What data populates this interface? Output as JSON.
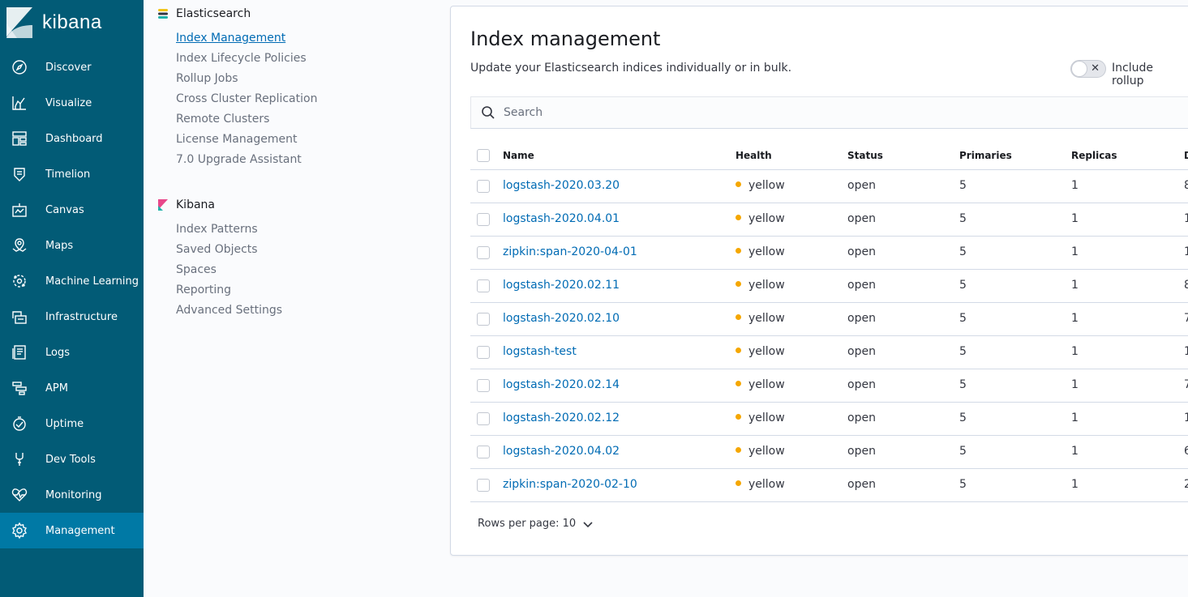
{
  "app": {
    "logo_text": "kibana"
  },
  "nav": [
    {
      "label": "Discover",
      "icon": "compass-icon"
    },
    {
      "label": "Visualize",
      "icon": "chart-icon"
    },
    {
      "label": "Dashboard",
      "icon": "dashboard-icon"
    },
    {
      "label": "Timelion",
      "icon": "timelion-icon"
    },
    {
      "label": "Canvas",
      "icon": "canvas-icon"
    },
    {
      "label": "Maps",
      "icon": "map-icon"
    },
    {
      "label": "Machine Learning",
      "icon": "ml-icon"
    },
    {
      "label": "Infrastructure",
      "icon": "infrastructure-icon"
    },
    {
      "label": "Logs",
      "icon": "logs-icon"
    },
    {
      "label": "APM",
      "icon": "apm-icon"
    },
    {
      "label": "Uptime",
      "icon": "uptime-icon"
    },
    {
      "label": "Dev Tools",
      "icon": "wrench-icon"
    },
    {
      "label": "Monitoring",
      "icon": "heartbeat-icon"
    },
    {
      "label": "Management",
      "icon": "gear-icon",
      "active": true
    }
  ],
  "subnav": {
    "elasticsearch": {
      "title": "Elasticsearch",
      "items": [
        "Index Management",
        "Index Lifecycle Policies",
        "Rollup Jobs",
        "Cross Cluster Replication",
        "Remote Clusters",
        "License Management",
        "7.0 Upgrade Assistant"
      ]
    },
    "kibana": {
      "title": "Kibana",
      "items": [
        "Index Patterns",
        "Saved Objects",
        "Spaces",
        "Reporting",
        "Advanced Settings"
      ]
    }
  },
  "page": {
    "title": "Index management",
    "description": "Update your Elasticsearch indices individually or in bulk.",
    "toggle_label": "Include rollup",
    "search_placeholder": "Search"
  },
  "table": {
    "columns": [
      "Name",
      "Health",
      "Status",
      "Primaries",
      "Replicas",
      "D"
    ],
    "rows": [
      {
        "name": "logstash-2020.03.20",
        "health": "yellow",
        "status": "open",
        "primaries": "5",
        "replicas": "1",
        "docs": "8"
      },
      {
        "name": "logstash-2020.04.01",
        "health": "yellow",
        "status": "open",
        "primaries": "5",
        "replicas": "1",
        "docs": "1"
      },
      {
        "name": "zipkin:span-2020-04-01",
        "health": "yellow",
        "status": "open",
        "primaries": "5",
        "replicas": "1",
        "docs": "1"
      },
      {
        "name": "logstash-2020.02.11",
        "health": "yellow",
        "status": "open",
        "primaries": "5",
        "replicas": "1",
        "docs": "8"
      },
      {
        "name": "logstash-2020.02.10",
        "health": "yellow",
        "status": "open",
        "primaries": "5",
        "replicas": "1",
        "docs": "7"
      },
      {
        "name": "logstash-test",
        "health": "yellow",
        "status": "open",
        "primaries": "5",
        "replicas": "1",
        "docs": "1"
      },
      {
        "name": "logstash-2020.02.14",
        "health": "yellow",
        "status": "open",
        "primaries": "5",
        "replicas": "1",
        "docs": "7"
      },
      {
        "name": "logstash-2020.02.12",
        "health": "yellow",
        "status": "open",
        "primaries": "5",
        "replicas": "1",
        "docs": "1"
      },
      {
        "name": "logstash-2020.04.02",
        "health": "yellow",
        "status": "open",
        "primaries": "5",
        "replicas": "1",
        "docs": "6"
      },
      {
        "name": "zipkin:span-2020-02-10",
        "health": "yellow",
        "status": "open",
        "primaries": "5",
        "replicas": "1",
        "docs": "2"
      }
    ],
    "rows_per_page": "Rows per page: 10"
  },
  "colors": {
    "sidebar": "#025b76",
    "active": "#0079a5",
    "link": "#006bb4",
    "health_yellow": "#f5a700"
  }
}
